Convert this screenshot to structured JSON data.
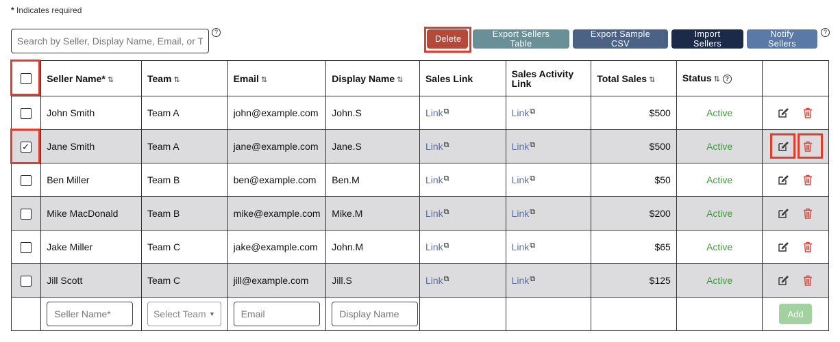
{
  "required_note": {
    "asterisk": "*",
    "text": "Indicates required"
  },
  "search": {
    "placeholder": "Search by Seller, Display Name, Email, or Team",
    "value": ""
  },
  "toolbar": {
    "delete_label": "Delete",
    "export_table_label": "Export Sellers Table",
    "export_csv_label": "Export Sample CSV",
    "import_label": "Import Sellers",
    "notify_label": "Notify Sellers"
  },
  "table": {
    "headers": {
      "seller_name": "Seller Name*",
      "team": "Team",
      "email": "Email",
      "display_name": "Display Name",
      "sales_link": "Sales Link",
      "sales_activity_link": "Sales Activity Link",
      "total_sales": "Total Sales",
      "status": "Status"
    },
    "rows": [
      {
        "checked": false,
        "seller": "John Smith",
        "team": "Team A",
        "email": "john@example.com",
        "display": "John.S",
        "sales_link": "Link",
        "activity_link": "Link",
        "total": "$500",
        "status": "Active"
      },
      {
        "checked": true,
        "seller": "Jane Smith",
        "team": "Team A",
        "email": "jane@example.com",
        "display": "Jane.S",
        "sales_link": "Link",
        "activity_link": "Link",
        "total": "$500",
        "status": "Active"
      },
      {
        "checked": false,
        "seller": "Ben Miller",
        "team": "Team B",
        "email": "ben@example.com",
        "display": "Ben.M",
        "sales_link": "Link",
        "activity_link": "Link",
        "total": "$50",
        "status": "Active"
      },
      {
        "checked": false,
        "seller": "Mike MacDonald",
        "team": "Team B",
        "email": "mike@example.com",
        "display": "Mike.M",
        "sales_link": "Link",
        "activity_link": "Link",
        "total": "$200",
        "status": "Active"
      },
      {
        "checked": false,
        "seller": "Jake Miller",
        "team": "Team C",
        "email": "jake@example.com",
        "display": "John.M",
        "sales_link": "Link",
        "activity_link": "Link",
        "total": "$65",
        "status": "Active"
      },
      {
        "checked": false,
        "seller": "Jill Scott",
        "team": "Team C",
        "email": "jill@example.com",
        "display": "Jill.S",
        "sales_link": "Link",
        "activity_link": "Link",
        "total": "$125",
        "status": "Active"
      }
    ],
    "new_row": {
      "seller_placeholder": "Seller Name*",
      "team_placeholder": "Select Team",
      "email_placeholder": "Email",
      "display_placeholder": "Display Name",
      "add_label": "Add"
    }
  },
  "colors": {
    "delete": "#b54a3a",
    "export_table": "#6a8f96",
    "export_csv": "#4b6285",
    "import": "#1b2a48",
    "notify": "#5b79a6",
    "status_active": "#3d9a3a",
    "trash": "#d9453b",
    "highlight": "#e23c2c",
    "alt_row": "#dcdcdf"
  }
}
